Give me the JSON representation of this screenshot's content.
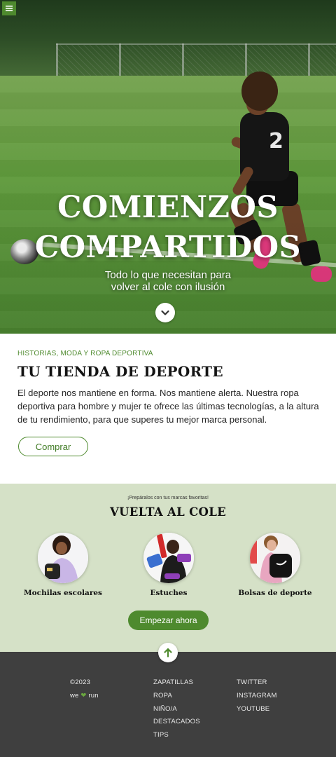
{
  "hero": {
    "menu_icon": "hamburger-icon",
    "title_line1": "COMIENZOS",
    "title_line2": "COMPARTIDOS",
    "subtitle_line1": "Todo lo que necesitan para",
    "subtitle_line2": "volver al cole con ilusión",
    "scroll_icon": "chevron-down-icon",
    "jersey_number": "2"
  },
  "store": {
    "eyebrow": "HISTORIAS, MODA Y ROPA DEPORTIVA",
    "title": "TU TIENDA DE DEPORTE",
    "body": "El deporte nos mantiene en forma. Nos mantiene alerta. Nuestra ropa deportiva para hombre y mujer te ofrece las últimas tecnologías, a la altura de tu rendimiento, para que superes tu mejor marca personal.",
    "button_label": "Comprar"
  },
  "back_to_school": {
    "eyebrow": "¡Prepáralos con tus marcas favoritas!",
    "title": "VUELTA AL COLE",
    "categories": [
      {
        "label": "Mochilas escolares"
      },
      {
        "label": "Estuches"
      },
      {
        "label": "Bolsas de deporte"
      }
    ],
    "button_label": "Empezar ahora"
  },
  "footer": {
    "scroll_top_icon": "arrow-up-icon",
    "copyright": "©2023",
    "brand_we": "we",
    "brand_heart": "❤",
    "brand_run": "run",
    "links_col1": [
      "ZAPATILLAS",
      "ROPA",
      "NIÑO/A",
      "DESTACADOS",
      "TIPS"
    ],
    "links_col2": [
      "TWITTER",
      "INSTAGRAM",
      "YOUTUBE"
    ]
  },
  "colors": {
    "accent": "#4e8a2e",
    "section_bg": "#d5e1c7",
    "footer_bg": "#3f3f3f"
  }
}
